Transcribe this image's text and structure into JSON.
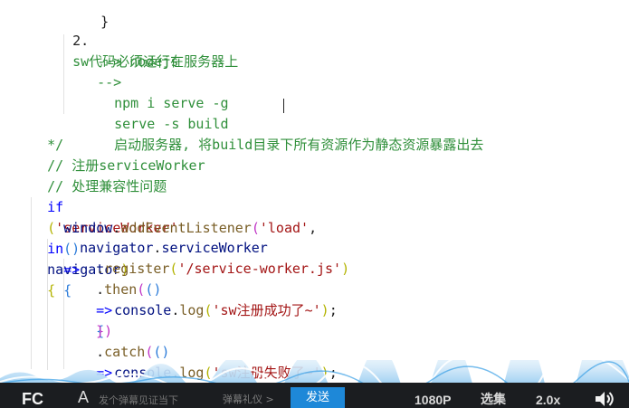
{
  "editor": {
    "line1": "}",
    "line2_num": "2.",
    "line2_text": "sw代码必须运行在服务器上",
    "line3": "--> nodejs",
    "line4": "-->",
    "line5": "npm i serve -g",
    "line6_cmd": "serve -s build",
    "line6_note": "启动服务器, 将build目录下所有资源作为静态资源暴露出去",
    "line7": "*/",
    "line8": "// 注册serviceWorker",
    "line9": "// 处理兼容性问题",
    "line10": {
      "kw_if": "if",
      "paren_open": "(",
      "str": "'serviceWorker'",
      "kw_in": "in",
      "var": "navigator",
      "paren_close": ")",
      "brace": "{"
    },
    "line11": {
      "obj": "window",
      "dot": ".",
      "method": "addEventListener",
      "paren_open": "(",
      "str": "'load'",
      "comma": ",",
      "arrow_parens": "()",
      "arrow": "=>",
      "brace": "{"
    },
    "line12": {
      "obj": "navigator",
      "dot": ".",
      "prop": "serviceWorker"
    },
    "line13": {
      "dot": ".",
      "method": "register",
      "paren_open": "(",
      "str": "'/service-worker.js'",
      "paren_close": ")"
    },
    "line14": {
      "dot": ".",
      "method": "then",
      "paren_open": "(",
      "arrow_parens": "()",
      "arrow": "=>",
      "brace": "{"
    },
    "line15": {
      "obj": "console",
      "dot": ".",
      "method": "log",
      "paren_open": "(",
      "str": "'sw注册成功了~'",
      "paren_close": ")",
      "semi": ";"
    },
    "line16": "})",
    "line17": {
      "dot": ".",
      "method": "catch",
      "paren_open": "(",
      "arrow_parens": "()",
      "arrow": "=>",
      "brace": "{"
    },
    "line18": {
      "obj": "console",
      "dot": ".",
      "method": "log",
      "paren_open": "(",
      "str": "'sw注册失败了~'",
      "paren_close": ")",
      "semi": ";"
    },
    "line19": "});",
    "line20": "});"
  },
  "player": {
    "logo": "FC",
    "danmu_icon": "A",
    "danmu_placeholder": "发个弹幕见证当下",
    "etiquette": "弹幕礼仪 >",
    "send": "发送",
    "quality": "1080P",
    "episodes": "选集",
    "speed": "2.0x",
    "volume_icon": "volume-icon"
  },
  "colors": {
    "comment": "#2f8f3a",
    "keyword": "#0000ff",
    "string": "#a31515",
    "function": "#795e26",
    "variable": "#001080",
    "send_button": "#1e88d8",
    "bar_bg": "#1b1d20",
    "wave": "#3aa0e6"
  }
}
